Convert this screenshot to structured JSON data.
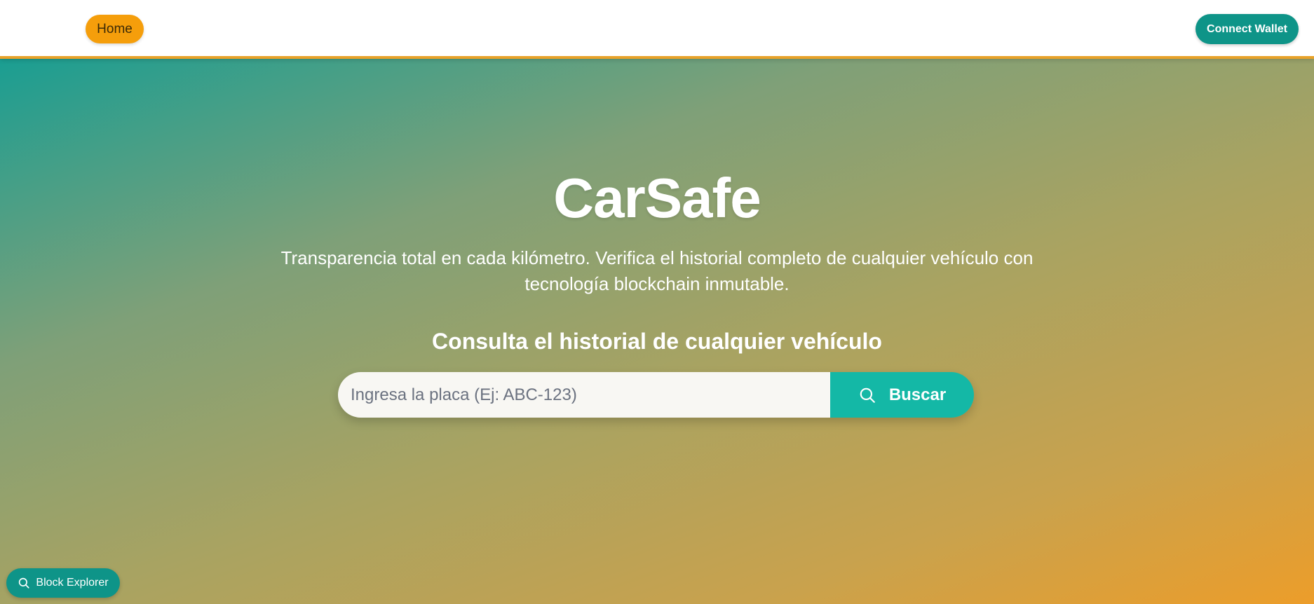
{
  "nav": {
    "home_label": "Home",
    "connect_label": "Connect Wallet"
  },
  "hero": {
    "title": "CarSafe",
    "subtitle": "Transparencia total en cada kilómetro. Verifica el historial completo de cualquier vehículo con tecnología blockchain inmutable.",
    "search_heading": "Consulta el historial de cualquier vehículo"
  },
  "search": {
    "placeholder": "Ingresa la placa (Ej: ABC-123)",
    "value": "",
    "button_label": "Buscar",
    "button_icon": "search-icon"
  },
  "floating": {
    "explorer_label": "Block Explorer",
    "explorer_icon": "search-icon"
  },
  "colors": {
    "accent_orange": "#f59e0b",
    "teal_primary": "#0e9488",
    "teal_button": "#14b8a6",
    "gradient_start": "#1a9e92",
    "gradient_end": "#ec9d2a"
  }
}
